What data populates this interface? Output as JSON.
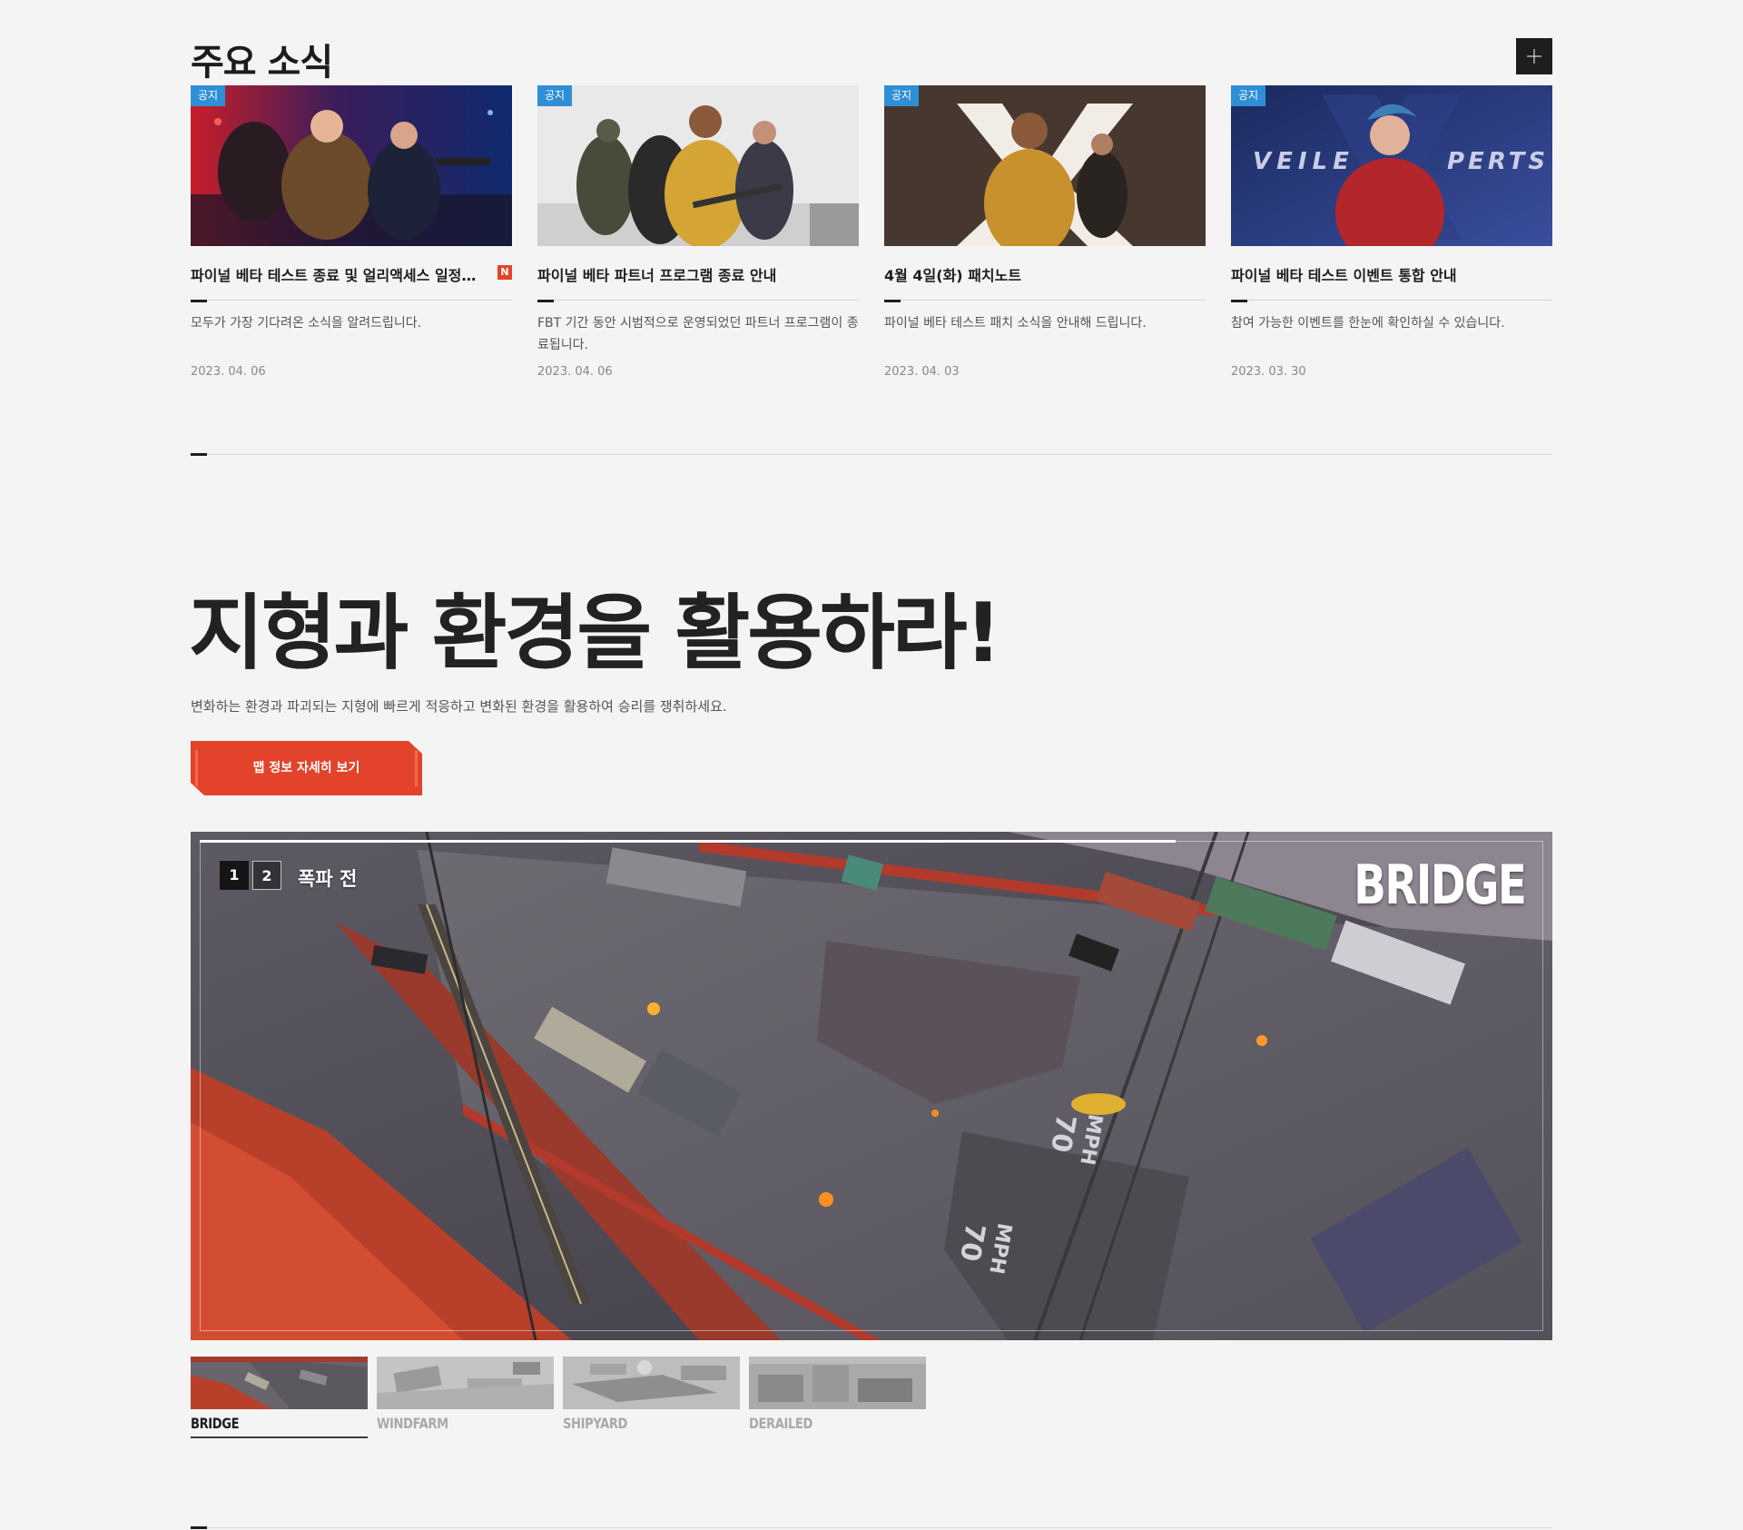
{
  "news": {
    "section_title": "주요 소식",
    "more_button": "+",
    "cards": [
      {
        "badge": "공지",
        "title": "파이널 베타 테스트 종료 및 얼리액세스 일정…",
        "new_badge": "N",
        "description": "모두가 가장 기다려온 소식을 알려드립니다.",
        "date": "2023. 04. 06",
        "image": "neon-city-squad"
      },
      {
        "badge": "공지",
        "title": "파이널 베타 파트너 프로그램 종료 안내",
        "description": "FBT 기간 동안 시범적으로 운영되었던 파트너 프로그램이 종료됩니다.",
        "date": "2023. 04. 06",
        "image": "squad-with-rifles"
      },
      {
        "badge": "공지",
        "title": "4월 4일(화) 패치노트",
        "description": "파이널 베타 테스트 패치 소식을 안내해 드립니다.",
        "date": "2023. 04. 03",
        "image": "x-logo-soldier"
      },
      {
        "badge": "공지",
        "title": "파이널 베타 테스트 이벤트 통합 안내",
        "description": "참여 가능한 이벤트를 한눈에 확인하실 수 있습니다.",
        "date": "2023. 03. 30",
        "image": "veiled-experts-hero",
        "image_text_left": "VEILE",
        "image_text_right": "PERTS"
      }
    ]
  },
  "map_section": {
    "headline": "지형과 환경을 활용하라!",
    "subline": "변화하는 환경과 파괴되는 지형에 빠르게 적응하고 변화된 환경을 활용하여 승리를 쟁취하세요.",
    "cta_label": "맵 정보 자세히 보기",
    "viewer": {
      "pages": [
        "1",
        "2"
      ],
      "phase_label": "폭파 전",
      "map_name": "BRIDGE",
      "road_markings": [
        "70",
        "MPH",
        "70",
        "MPH"
      ]
    },
    "thumbnails": [
      {
        "label": "BRIDGE",
        "active": true
      },
      {
        "label": "WINDFARM",
        "active": false
      },
      {
        "label": "SHIPYARD",
        "active": false
      },
      {
        "label": "DERAILED",
        "active": false
      }
    ]
  },
  "colors": {
    "badge_blue": "#2f8fd6",
    "new_red": "#e2432a",
    "cta_orange": "#e2432a",
    "background": "#f4f4f4"
  }
}
